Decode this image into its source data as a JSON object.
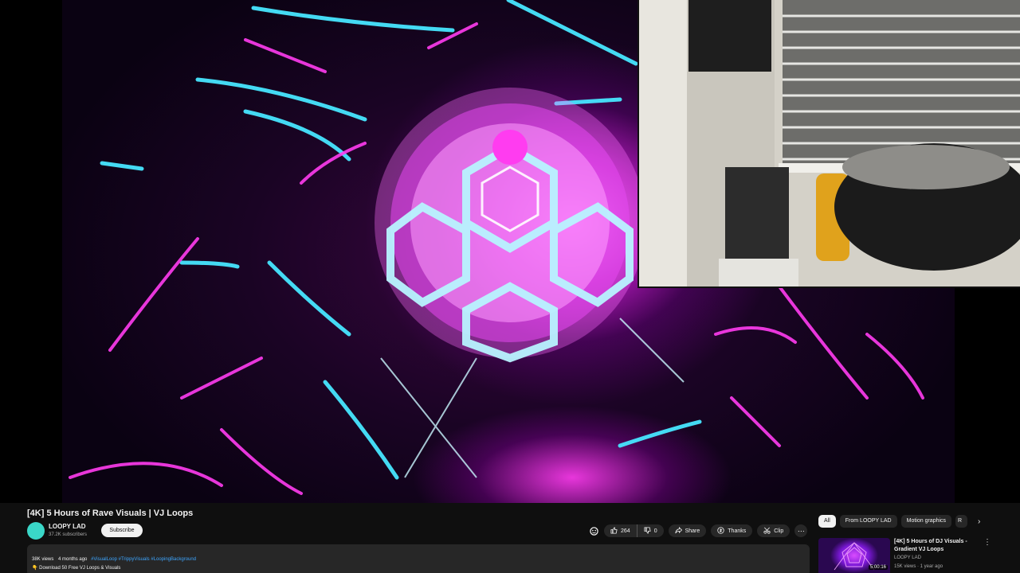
{
  "video": {
    "title": "[4K] 5 Hours of Rave Visuals | VJ Loops"
  },
  "channel": {
    "name": "LOOPY LAD",
    "subscribers": "37.2K subscribers",
    "subscribe_label": "Subscribe"
  },
  "actions": {
    "like_count": "264",
    "dislike_count": "0",
    "share_label": "Share",
    "thanks_label": "Thanks",
    "clip_label": "Clip",
    "more_glyph": "⋯",
    "like_icon": "thumbs-up-icon",
    "dislike_icon": "thumbs-down-icon",
    "share_icon": "share-icon",
    "thanks_icon": "thanks-icon",
    "clip_icon": "scissors-icon"
  },
  "description": {
    "views": "38K views",
    "age": "4 months ago",
    "hashtags": "#VisualLoop #TrippyVisuals #LoopingBackground",
    "line1": "👇 Download 50 Free VJ Loops & Visuals"
  },
  "sidebar": {
    "chips": [
      "All",
      "From LOOPY LAD",
      "Motion graphics",
      "R"
    ],
    "active_chip": "All",
    "next_icon": "chevron-right-icon",
    "related": [
      {
        "title": "[4K] 5 Hours of DJ Visuals - Gradient VJ Loops",
        "channel": "LOOPY LAD",
        "views": "15K views",
        "age": "1 year ago",
        "meta": "15K views · 1 year ago",
        "duration": "5:00:16"
      }
    ]
  },
  "colors": {
    "background": "#0f0f0f",
    "surface": "#272727",
    "text": "#f1f1f1",
    "secondary_text": "#aaaaaa",
    "link": "#3ea6ff",
    "avatar": "#3ad7c8",
    "neon_magenta": "#ff3cf0",
    "neon_cyan": "#3fe3ff"
  }
}
